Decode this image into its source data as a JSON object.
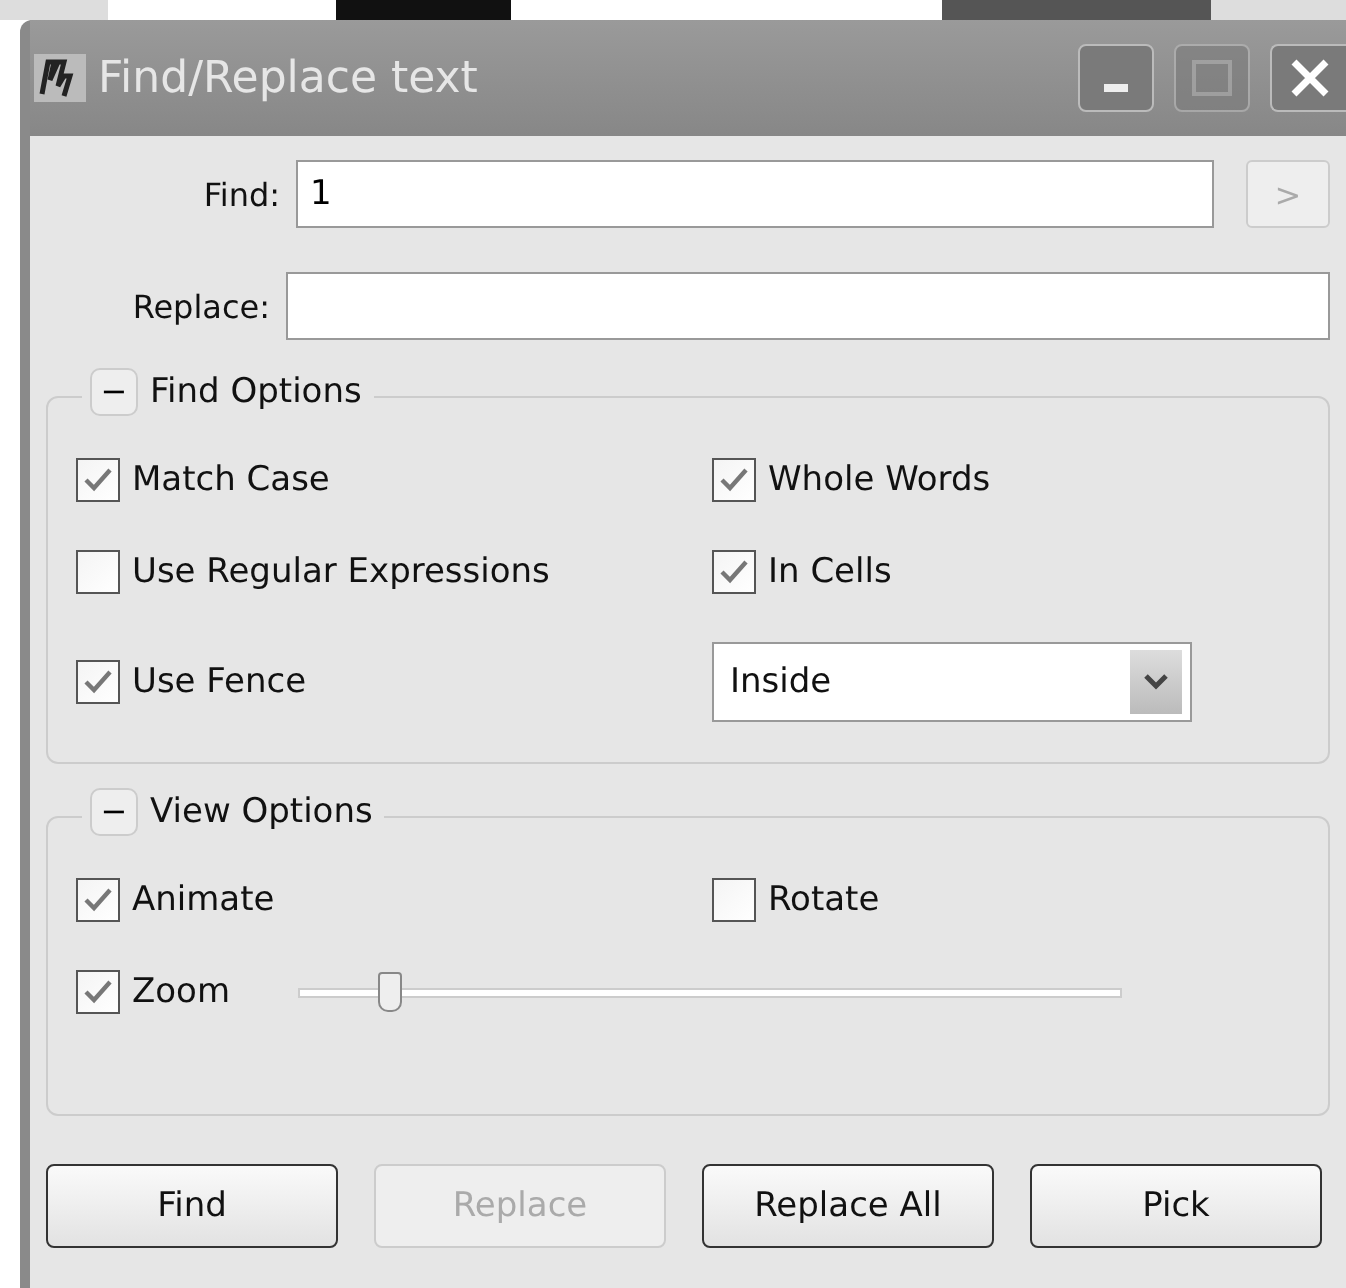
{
  "window": {
    "title": "Find/Replace text"
  },
  "find": {
    "label": "Find:",
    "value": "1",
    "next_button": ">",
    "next_disabled": true
  },
  "replace": {
    "label": "Replace:"
  },
  "find_options": {
    "title": "Find Options",
    "toggle": "−",
    "items": [
      {
        "kind": "checkbox",
        "label": "Match Case",
        "checked": true
      },
      {
        "kind": "checkbox",
        "label": "Whole Words",
        "checked": true
      },
      {
        "kind": "checkbox",
        "label": "Use Regular Expressions",
        "checked": false
      },
      {
        "kind": "checkbox",
        "label": "In Cells",
        "checked": true
      },
      {
        "kind": "checkbox",
        "label": "Use Fence",
        "checked": true
      },
      {
        "kind": "dropdown",
        "value": "Inside"
      }
    ]
  },
  "view_options": {
    "title": "View Options",
    "toggle": "−",
    "items": [
      {
        "kind": "checkbox",
        "label": "Animate",
        "checked": true
      },
      {
        "kind": "checkbox",
        "label": "Rotate",
        "checked": false
      },
      {
        "kind": "checkbox",
        "label": "Zoom",
        "checked": true
      },
      {
        "kind": "slider",
        "level": 0.11
      }
    ]
  },
  "buttons": [
    {
      "label": "Find",
      "disabled": false
    },
    {
      "label": "Replace",
      "disabled": true
    },
    {
      "label": "Replace All",
      "disabled": false
    },
    {
      "label": "Pick",
      "disabled": false
    }
  ]
}
